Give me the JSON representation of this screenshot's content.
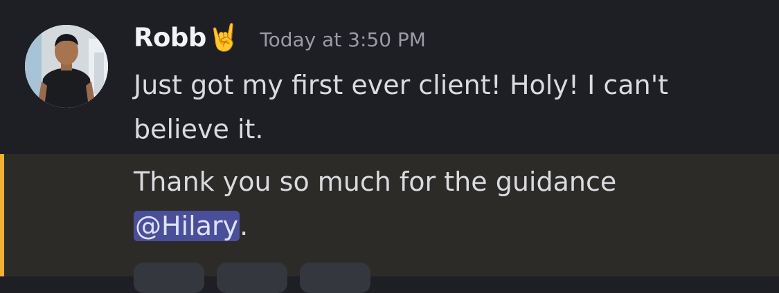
{
  "message": {
    "author": "Robb",
    "author_badge_emoji": "🤘",
    "timestamp": "Today at 3:50 PM",
    "line1": "Just got my first ever client! Holy! I can't",
    "line2": "believe it.",
    "line3": "Thank you so much for the guidance",
    "mention": "@Hilary",
    "line4_suffix": "."
  },
  "colors": {
    "background": "#1e1f24",
    "mention_highlight_bg": "#2d2b28",
    "mention_bar": "#f0b232",
    "mention_pill": "#4a4f99"
  },
  "icons": [
    "avatar-photo",
    "sign-of-the-horns-emoji"
  ]
}
